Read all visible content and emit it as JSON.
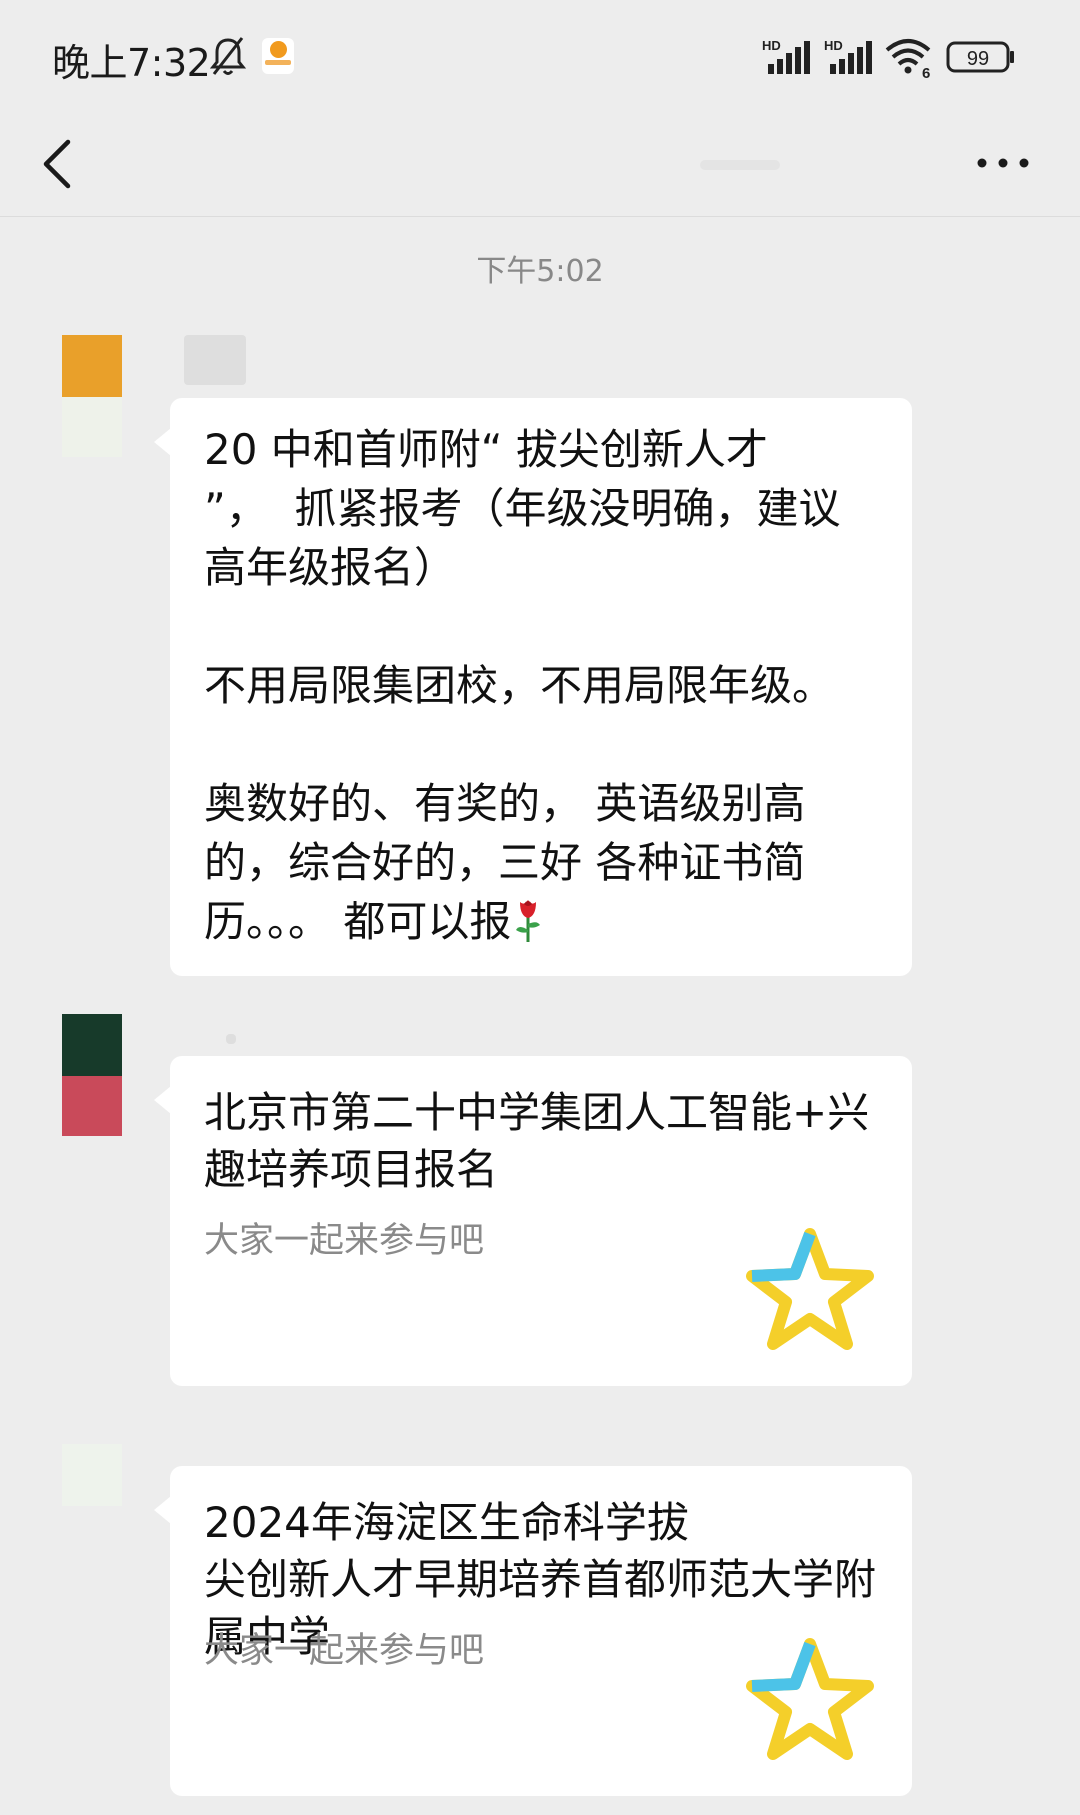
{
  "status_bar": {
    "time": "晚上7:32",
    "signal_label_1": "HD",
    "signal_label_2": "HD",
    "wifi_badge": "6",
    "battery": "99"
  },
  "chat": {
    "timestamp": "下午5:02"
  },
  "messages": [
    {
      "type": "text",
      "avatar_colors": [
        "#e9a02a",
        "#eef2ea"
      ],
      "lines": [
        "20 中和首师附“ 拔尖创新人才",
        "”，  抓紧报考（年级没明确，建议",
        "高年级报名）",
        "",
        "不用局限集团校，不用局限年级。",
        "",
        "奥数好的、有奖的， 英语级别高",
        "的，综合好的，三好 各种证书简",
        "历。。。 都可以报"
      ],
      "emoji": "rose"
    },
    {
      "type": "card",
      "avatar_colors": [
        "#173a2a",
        "#c94a5a"
      ],
      "title": "北京市第二十中学集团人工智能+兴趣培养项目报名",
      "description": "大家一起来参与吧",
      "thumbnail": "star-icon"
    },
    {
      "type": "card",
      "avatar_colors": [
        "#eef3ec",
        "#ededed"
      ],
      "title": "2024年海淀区生命科学拔尖创新人才早期培养首都师范大学附属中学",
      "description": "大家一起来参与吧",
      "thumbnail": "star-icon"
    }
  ]
}
